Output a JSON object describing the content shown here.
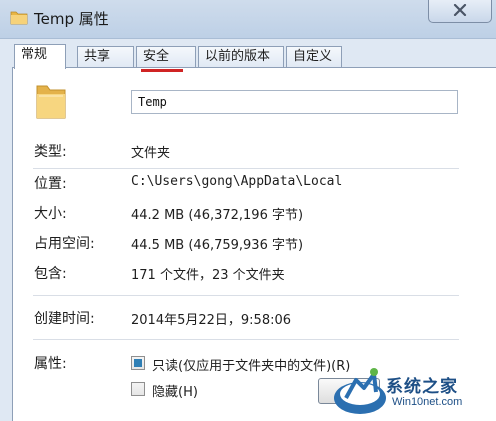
{
  "window": {
    "title": "Temp 属性",
    "close_label": "×"
  },
  "tabs": [
    {
      "label": "常规",
      "active": true
    },
    {
      "label": "共享",
      "active": false
    },
    {
      "label": "安全",
      "active": false
    },
    {
      "label": "以前的版本",
      "active": false
    },
    {
      "label": "自定义",
      "active": false
    }
  ],
  "general": {
    "name_value": "Temp",
    "fields": {
      "type": {
        "label": "类型:",
        "value": "文件夹"
      },
      "location": {
        "label": "位置:",
        "value": "C:\\Users\\gong\\AppData\\Local"
      },
      "size": {
        "label": "大小:",
        "value": "44.2 MB (46,372,196 字节)"
      },
      "disk": {
        "label": "占用空间:",
        "value": "44.5 MB (46,759,936 字节)"
      },
      "contains": {
        "label": "包含:",
        "value": "171 个文件，23 个文件夹"
      },
      "created": {
        "label": "创建时间:",
        "value": "2014年5月22日，9:58:06"
      }
    },
    "attributes": {
      "label": "属性:",
      "readonly_label": "只读(仅应用于文件夹中的文件)(R)",
      "readonly_state": "indeterminate",
      "hidden_label": "隐藏(H)",
      "hidden_checked": false
    }
  },
  "watermark": {
    "main": "系统之家",
    "sub": "Win10net.com"
  },
  "colors": {
    "accent": "#2f7fb5",
    "tab_marker": "#d02424",
    "folder": "#f2c95c"
  }
}
